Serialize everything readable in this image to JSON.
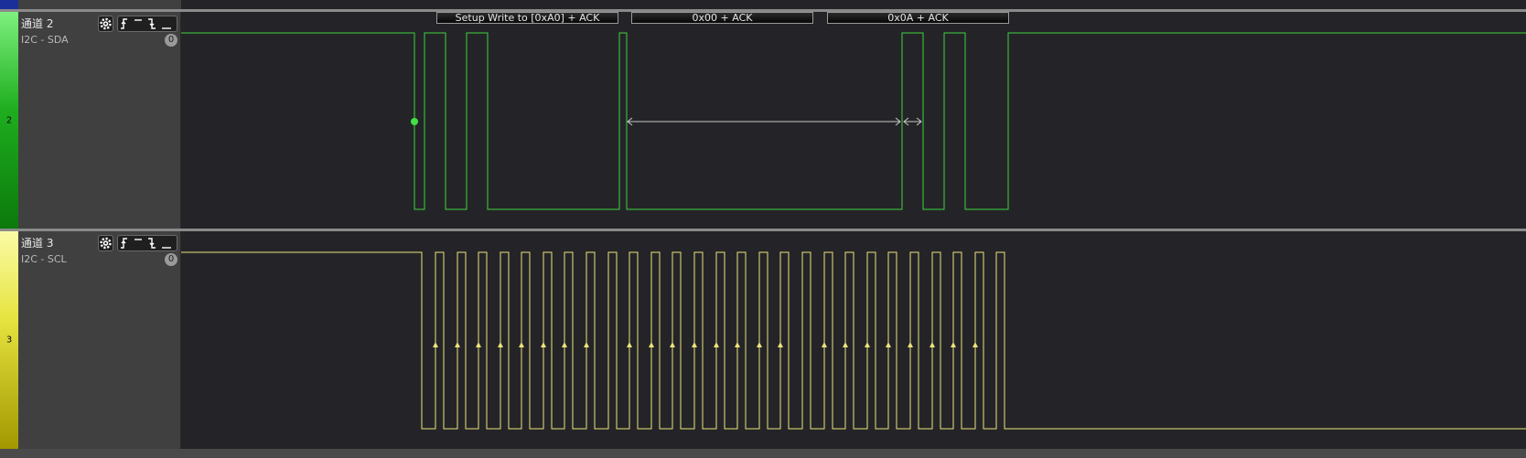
{
  "channels": [
    {
      "name": "通道 2",
      "protocol": "I2C - SDA",
      "index": "2",
      "badge": "0",
      "color": "#2fd62f",
      "annotations": [
        "Setup Write to [0xA0] + ACK",
        "0x00 + ACK",
        "0x0A + ACK"
      ]
    },
    {
      "name": "通道 3",
      "protocol": "I2C - SCL",
      "index": "3",
      "badge": "0",
      "color": "#e9e24a"
    }
  ],
  "colors": {
    "background": "#242428",
    "panel": "#404040",
    "sda_wave": "#3ed23e",
    "scl_wave": "#ece37a"
  },
  "icons": [
    "gear-icon",
    "rising-edge-icon",
    "high-level-icon",
    "falling-edge-icon",
    "low-level-icon"
  ]
}
